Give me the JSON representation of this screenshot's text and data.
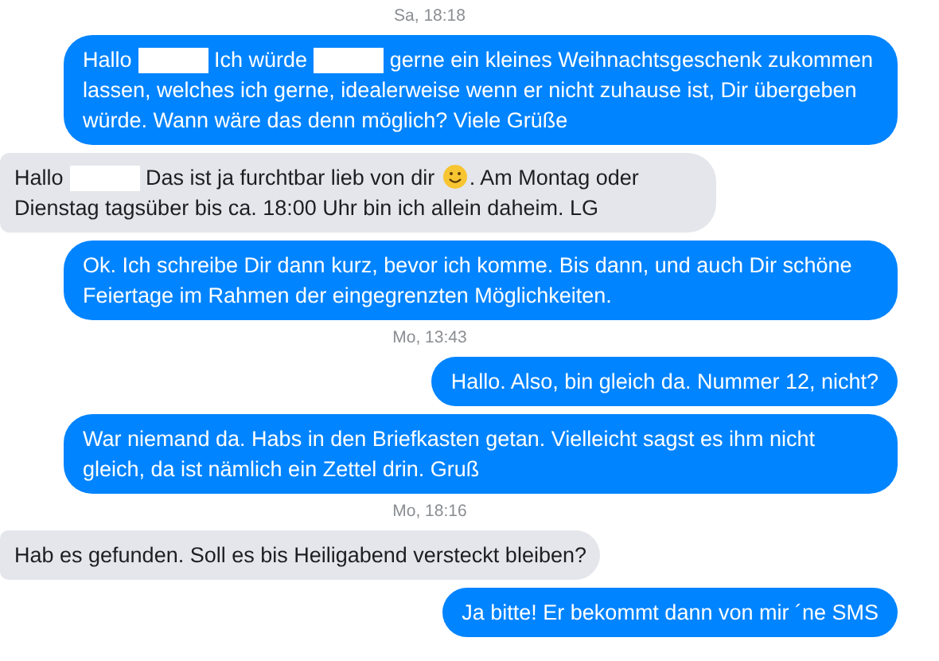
{
  "messages": [
    {
      "kind": "time",
      "text": "Sa, 18:18"
    },
    {
      "kind": "sent",
      "parts": [
        {
          "kind": "text",
          "text": "Hallo"
        },
        {
          "kind": "redacted"
        },
        {
          "kind": "text",
          "text": "Ich würde"
        },
        {
          "kind": "redacted"
        },
        {
          "kind": "text",
          "text": "gerne ein kleines Weihnachtsgeschenk zukommen lassen, welches ich gerne, idealerweise wenn er nicht zuhause ist, Dir übergeben würde. Wann wäre das denn möglich? Viele Grüße"
        }
      ]
    },
    {
      "kind": "received",
      "parts": [
        {
          "kind": "text",
          "text": "Hallo"
        },
        {
          "kind": "redacted"
        },
        {
          "kind": "text",
          "text": "Das ist ja furchtbar lieb von dir"
        },
        {
          "kind": "emoji"
        },
        {
          "kind": "text",
          "text": ". Am Montag oder Dienstag tagsüber bis ca. 18:00 Uhr bin ich allein daheim. LG"
        }
      ]
    },
    {
      "kind": "sent",
      "parts": [
        {
          "kind": "text",
          "text": "Ok. Ich schreibe Dir dann kurz, bevor ich komme. Bis dann, und auch Dir schöne Feiertage im Rahmen der eingegrenzten Möglichkeiten."
        }
      ]
    },
    {
      "kind": "time",
      "text": "Mo, 13:43"
    },
    {
      "kind": "sent",
      "parts": [
        {
          "kind": "text",
          "text": "Hallo. Also, bin gleich da. Nummer 12, nicht?"
        }
      ]
    },
    {
      "kind": "sent",
      "parts": [
        {
          "kind": "text",
          "text": "War niemand da. Habs in den Briefkasten getan. Vielleicht sagst es ihm nicht gleich, da ist nämlich ein Zettel drin. Gruß"
        }
      ]
    },
    {
      "kind": "time",
      "text": "Mo, 18:16"
    },
    {
      "kind": "received",
      "parts": [
        {
          "kind": "text",
          "text": "Hab es gefunden. Soll es bis Heiligabend versteckt bleiben?"
        }
      ]
    },
    {
      "kind": "sent",
      "parts": [
        {
          "kind": "text",
          "text": "Ja bitte! Er bekommt dann von mir ´ne SMS"
        }
      ]
    }
  ]
}
